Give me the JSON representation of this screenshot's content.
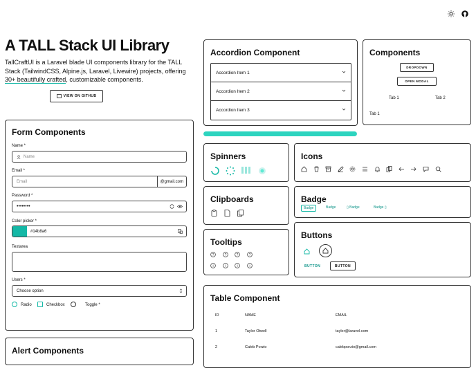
{
  "top": {
    "theme_icon": "sun-icon",
    "github_icon": "github-icon"
  },
  "hero": {
    "title": "A TALL Stack UI Library",
    "desc_1": "TallCraftUI is a Laravel blade UI components library for the TALL",
    "desc_2": "Stack (TailwindCSS, Alpine.js, Laravel, Livewire) projects, offering",
    "desc_link": "30+ beautifully crafted",
    "desc_3": ", customizable components.",
    "github_button": "VIEW ON GITHUB"
  },
  "form": {
    "title": "Form Components",
    "name_label": "Name *",
    "name_placeholder": "Name",
    "email_label": "Email *",
    "email_placeholder": "Email",
    "email_suffix": "@gmail.com",
    "password_label": "Password *",
    "password_value": "••••••••",
    "color_label": "Color picker *",
    "color_value": "#14b8a6",
    "textarea_label": "Textarea",
    "users_label": "Users *",
    "users_value": "Choose option",
    "radio_label": "Radio",
    "checkbox_label": "Checkbox",
    "toggle_label": "Toggle *"
  },
  "alert": {
    "title": "Alert Components"
  },
  "accordion": {
    "title": "Accordion Component",
    "items": [
      "Accordion Item 1",
      "Accordion Item 2",
      "Accordion Item 3"
    ]
  },
  "components": {
    "title": "Components",
    "dropdown": "DROPDOWN",
    "modal": "OPEN MODAL",
    "tab1": "Tab 1",
    "tab2": "Tab 2",
    "tab_content": "Tab 1"
  },
  "progress": {
    "value": 1.0,
    "color": "#2dd4bf"
  },
  "spinners": {
    "title": "Spinners"
  },
  "icons": {
    "title": "Icons",
    "names": [
      "home-icon",
      "trash-icon",
      "archive-icon",
      "edit-icon",
      "cog-icon",
      "menu-icon",
      "bell-icon",
      "copy-icon",
      "arrow-left-icon",
      "arrow-right-icon",
      "chat-icon",
      "search-icon"
    ]
  },
  "clipboards": {
    "title": "Clipboards"
  },
  "badge": {
    "title": "Badge",
    "items": [
      "Badge",
      "Badge",
      "Badge",
      "Badge"
    ]
  },
  "tooltips": {
    "title": "Tooltips"
  },
  "buttons": {
    "title": "Buttons",
    "teal_label": "BUTTON",
    "outline_label": "BUTTON"
  },
  "table": {
    "title": "Table Component",
    "headers": [
      "ID",
      "NAME",
      "EMAIL"
    ],
    "rows": [
      [
        "1",
        "Taylor Otwell",
        "taylor@laravel.com"
      ],
      [
        "2",
        "Caleb Porzio",
        "calebporzio@gmail.com"
      ]
    ]
  },
  "colors": {
    "accent": "#14b8a6",
    "teal_text": "#0d9488"
  }
}
